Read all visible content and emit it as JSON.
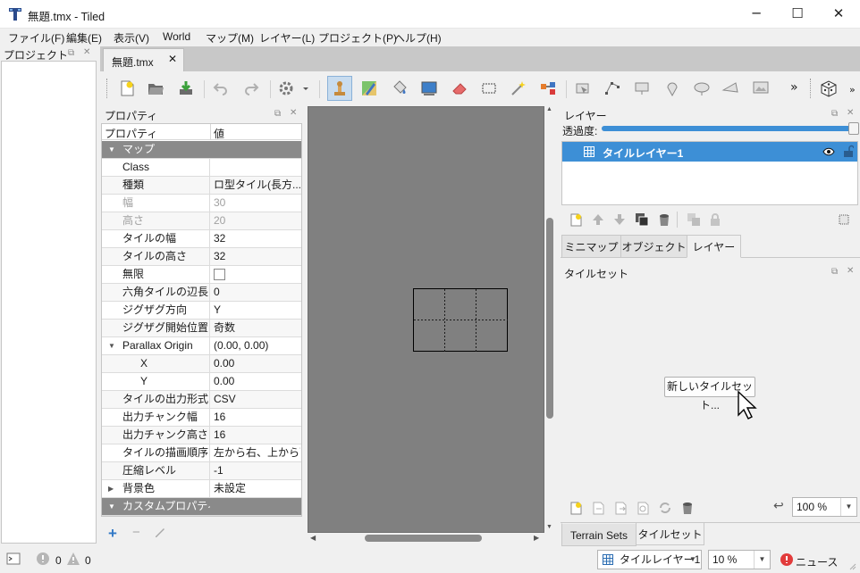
{
  "window": {
    "title": "無題.tmx - Tiled",
    "minimize": "─",
    "maximize": "☐",
    "close": "✕"
  },
  "menu": [
    "ファイル(F)",
    "編集(E)",
    "表示(V)",
    "World",
    "マップ(M)",
    "レイヤー(L)",
    "プロジェクト(P)",
    "ヘルプ(H)"
  ],
  "project_panel": {
    "title": "プロジェクト"
  },
  "doc_tab": {
    "label": "無題.tmx",
    "close": "✕"
  },
  "toolbar": {
    "more": "»"
  },
  "properties": {
    "title": "プロパティ",
    "col_name": "プロパティ",
    "col_value": "値",
    "rows": [
      {
        "name": "マップ",
        "value": "",
        "type": "group",
        "arrow": "▼"
      },
      {
        "name": "Class",
        "value": ""
      },
      {
        "name": "種類",
        "value": "ロ型タイル(長方..."
      },
      {
        "name": "幅",
        "value": "30",
        "disabled": true
      },
      {
        "name": "高さ",
        "value": "20",
        "disabled": true
      },
      {
        "name": "タイルの幅",
        "value": "32"
      },
      {
        "name": "タイルの高さ",
        "value": "32"
      },
      {
        "name": "無限",
        "value": "",
        "checkbox": true
      },
      {
        "name": "六角タイルの辺長",
        "value": "0"
      },
      {
        "name": "ジグザグ方向",
        "value": "Y"
      },
      {
        "name": "ジグザグ開始位置",
        "value": "奇数"
      },
      {
        "name": "Parallax Origin",
        "value": "(0.00, 0.00)",
        "arrow": "▼"
      },
      {
        "name": "X",
        "value": "0.00",
        "indent": true
      },
      {
        "name": "Y",
        "value": "0.00",
        "indent": true
      },
      {
        "name": "タイルの出力形式",
        "value": "CSV"
      },
      {
        "name": "出力チャンク幅",
        "value": "16"
      },
      {
        "name": "出力チャンク高さ",
        "value": "16"
      },
      {
        "name": "タイルの描画順序",
        "value": "左から右、上から下"
      },
      {
        "name": "圧縮レベル",
        "value": "-1"
      },
      {
        "name": "背景色",
        "value": "未設定",
        "arrow": "▶"
      },
      {
        "name": "カスタムプロパティ",
        "value": "",
        "type": "group",
        "arrow": "▼"
      }
    ]
  },
  "layers_panel": {
    "title": "レイヤー",
    "opacity_label": "透過度:",
    "opacity": 1.0,
    "layers": [
      {
        "name": "タイルレイヤー1",
        "visible": true
      }
    ],
    "tabs": [
      "ミニマップ",
      "オブジェクト",
      "レイヤー"
    ]
  },
  "tilesets_panel": {
    "title": "タイルセット",
    "new_button": "新しいタイルセット...",
    "zoom": "100 %",
    "tabs": [
      "Terrain Sets",
      "タイルセット"
    ]
  },
  "statusbar": {
    "errors": "0",
    "warnings": "0",
    "layer": "タイルレイヤー1",
    "zoom": "10 %",
    "news": "ニュース"
  },
  "colors": {
    "accent": "#3d8fd6",
    "canvas": "#808080",
    "group_header": "#8a8a8a"
  }
}
